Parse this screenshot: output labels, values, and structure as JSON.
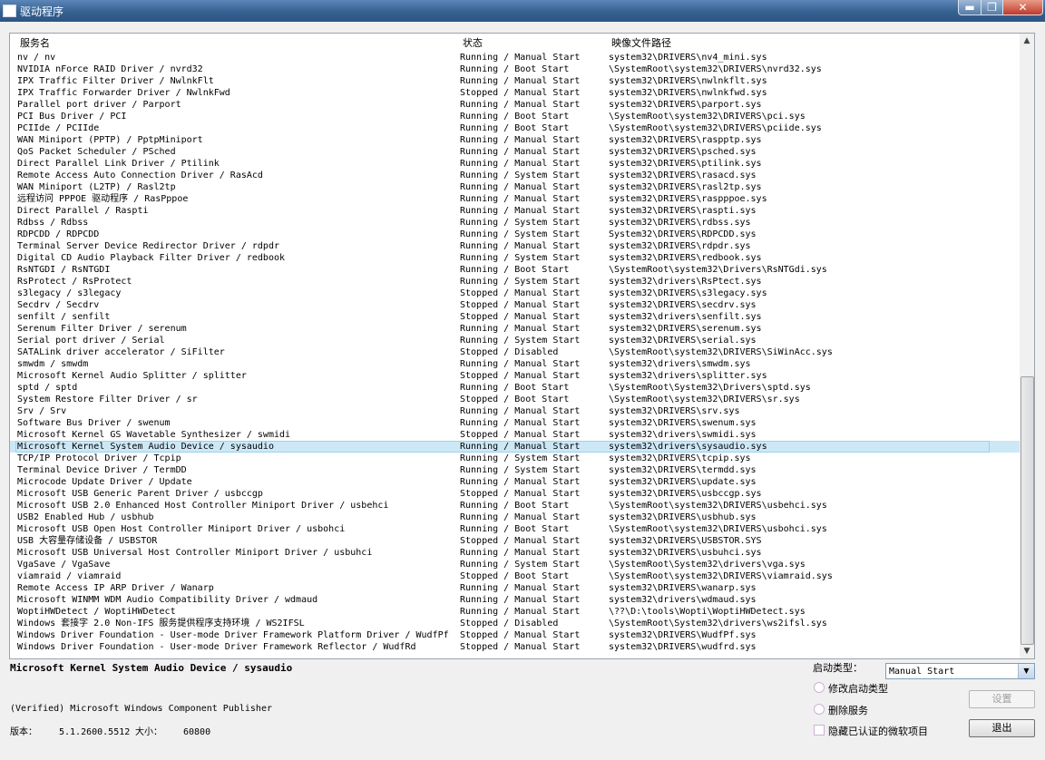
{
  "window": {
    "title": "驱动程序",
    "min_glyph": "▬",
    "max_glyph": "❐",
    "close_glyph": "✕"
  },
  "columns": {
    "name": "服务名",
    "status": "状态",
    "path": "映像文件路径"
  },
  "scroll": {
    "up": "▲",
    "down": "▼"
  },
  "rows": [
    [
      "nv / nv",
      "Running / Manual Start",
      "system32\\DRIVERS\\nv4_mini.sys"
    ],
    [
      "NVIDIA nForce RAID Driver / nvrd32",
      "Running / Boot Start",
      "\\SystemRoot\\system32\\DRIVERS\\nvrd32.sys"
    ],
    [
      "IPX Traffic Filter Driver / NwlnkFlt",
      "Running / Manual Start",
      "system32\\DRIVERS\\nwlnkflt.sys"
    ],
    [
      "IPX Traffic Forwarder Driver / NwlnkFwd",
      "Stopped / Manual Start",
      "system32\\DRIVERS\\nwlnkfwd.sys"
    ],
    [
      "Parallel port driver / Parport",
      "Running / Manual Start",
      "system32\\DRIVERS\\parport.sys"
    ],
    [
      "PCI Bus Driver / PCI",
      "Running / Boot Start",
      "\\SystemRoot\\system32\\DRIVERS\\pci.sys"
    ],
    [
      "PCIIde / PCIIde",
      "Running / Boot Start",
      "\\SystemRoot\\system32\\DRIVERS\\pciide.sys"
    ],
    [
      "WAN Miniport (PPTP) / PptpMiniport",
      "Running / Manual Start",
      "system32\\DRIVERS\\raspptp.sys"
    ],
    [
      "QoS Packet Scheduler / PSched",
      "Running / Manual Start",
      "system32\\DRIVERS\\psched.sys"
    ],
    [
      "Direct Parallel Link Driver / Ptilink",
      "Running / Manual Start",
      "system32\\DRIVERS\\ptilink.sys"
    ],
    [
      "Remote Access Auto Connection Driver / RasAcd",
      "Running / System Start",
      "system32\\DRIVERS\\rasacd.sys"
    ],
    [
      "WAN Miniport (L2TP) / Rasl2tp",
      "Running / Manual Start",
      "system32\\DRIVERS\\rasl2tp.sys"
    ],
    [
      "远程访问 PPPOE 驱动程序 / RasPppoe",
      "Running / Manual Start",
      "system32\\DRIVERS\\raspppoe.sys"
    ],
    [
      "Direct Parallel / Raspti",
      "Running / Manual Start",
      "system32\\DRIVERS\\raspti.sys"
    ],
    [
      "Rdbss / Rdbss",
      "Running / System Start",
      "system32\\DRIVERS\\rdbss.sys"
    ],
    [
      "RDPCDD / RDPCDD",
      "Running / System Start",
      "System32\\DRIVERS\\RDPCDD.sys"
    ],
    [
      "Terminal Server Device Redirector Driver / rdpdr",
      "Running / Manual Start",
      "system32\\DRIVERS\\rdpdr.sys"
    ],
    [
      "Digital CD Audio Playback Filter Driver / redbook",
      "Running / System Start",
      "system32\\DRIVERS\\redbook.sys"
    ],
    [
      "RsNTGDI / RsNTGDI",
      "Running / Boot Start",
      "\\SystemRoot\\system32\\Drivers\\RsNTGdi.sys"
    ],
    [
      "RsProtect / RsProtect",
      "Running / System Start",
      "system32\\drivers\\RsPtect.sys"
    ],
    [
      "s3legacy / s3legacy",
      "Stopped / Manual Start",
      "system32\\DRIVERS\\s3legacy.sys"
    ],
    [
      "Secdrv / Secdrv",
      "Stopped / Manual Start",
      "system32\\DRIVERS\\secdrv.sys"
    ],
    [
      "senfilt / senfilt",
      "Stopped / Manual Start",
      "system32\\drivers\\senfilt.sys"
    ],
    [
      "Serenum Filter Driver / serenum",
      "Running / Manual Start",
      "system32\\DRIVERS\\serenum.sys"
    ],
    [
      "Serial port driver / Serial",
      "Running / System Start",
      "system32\\DRIVERS\\serial.sys"
    ],
    [
      "SATALink driver accelerator / SiFilter",
      "Stopped / Disabled",
      "\\SystemRoot\\system32\\DRIVERS\\SiWinAcc.sys"
    ],
    [
      "smwdm / smwdm",
      "Running / Manual Start",
      "system32\\drivers\\smwdm.sys"
    ],
    [
      "Microsoft Kernel Audio Splitter / splitter",
      "Stopped / Manual Start",
      "system32\\drivers\\splitter.sys"
    ],
    [
      "sptd / sptd",
      "Running / Boot Start",
      "\\SystemRoot\\System32\\Drivers\\sptd.sys"
    ],
    [
      "System Restore Filter Driver / sr",
      "Stopped / Boot Start",
      "\\SystemRoot\\system32\\DRIVERS\\sr.sys"
    ],
    [
      "Srv / Srv",
      "Running / Manual Start",
      "system32\\DRIVERS\\srv.sys"
    ],
    [
      "Software Bus Driver / swenum",
      "Running / Manual Start",
      "system32\\DRIVERS\\swenum.sys"
    ],
    [
      "Microsoft Kernel GS Wavetable Synthesizer / swmidi",
      "Stopped / Manual Start",
      "system32\\drivers\\swmidi.sys"
    ],
    [
      "Microsoft Kernel System Audio Device / sysaudio",
      "Running / Manual Start",
      "system32\\drivers\\sysaudio.sys"
    ],
    [
      "TCP/IP Protocol Driver / Tcpip",
      "Running / System Start",
      "system32\\DRIVERS\\tcpip.sys"
    ],
    [
      "Terminal Device Driver / TermDD",
      "Running / System Start",
      "system32\\DRIVERS\\termdd.sys"
    ],
    [
      "Microcode Update Driver / Update",
      "Running / Manual Start",
      "system32\\DRIVERS\\update.sys"
    ],
    [
      "Microsoft USB Generic Parent Driver / usbccgp",
      "Stopped / Manual Start",
      "system32\\DRIVERS\\usbccgp.sys"
    ],
    [
      "Microsoft USB 2.0 Enhanced Host Controller Miniport Driver / usbehci",
      "Running / Boot Start",
      "\\SystemRoot\\system32\\DRIVERS\\usbehci.sys"
    ],
    [
      "USB2 Enabled Hub / usbhub",
      "Running / Manual Start",
      "system32\\DRIVERS\\usbhub.sys"
    ],
    [
      "Microsoft USB Open Host Controller Miniport Driver / usbohci",
      "Running / Boot Start",
      "\\SystemRoot\\system32\\DRIVERS\\usbohci.sys"
    ],
    [
      "USB 大容量存储设备 / USBSTOR",
      "Stopped / Manual Start",
      "system32\\DRIVERS\\USBSTOR.SYS"
    ],
    [
      "Microsoft USB Universal Host Controller Miniport Driver / usbuhci",
      "Running / Manual Start",
      "system32\\DRIVERS\\usbuhci.sys"
    ],
    [
      "VgaSave / VgaSave",
      "Running / System Start",
      "\\SystemRoot\\System32\\drivers\\vga.sys"
    ],
    [
      "viamraid / viamraid",
      "Stopped / Boot Start",
      "\\SystemRoot\\system32\\DRIVERS\\viamraid.sys"
    ],
    [
      "Remote Access IP ARP Driver / Wanarp",
      "Running / Manual Start",
      "system32\\DRIVERS\\wanarp.sys"
    ],
    [
      "Microsoft WINMM WDM Audio Compatibility Driver / wdmaud",
      "Running / Manual Start",
      "system32\\drivers\\wdmaud.sys"
    ],
    [
      "WoptiHWDetect / WoptiHWDetect",
      "Running / Manual Start",
      "\\??\\D:\\tools\\Wopti\\WoptiHWDetect.sys"
    ],
    [
      "Windows 套接字 2.0 Non-IFS 服务提供程序支持环境 / WS2IFSL",
      "Stopped / Disabled",
      "\\SystemRoot\\System32\\drivers\\ws2ifsl.sys"
    ],
    [
      "Windows Driver Foundation - User-mode Driver Framework Platform Driver / WudfPf",
      "Stopped / Manual Start",
      "system32\\DRIVERS\\WudfPf.sys"
    ],
    [
      "Windows Driver Foundation - User-mode Driver Framework Reflector / WudfRd",
      "Stopped / Manual Start",
      "system32\\DRIVERS\\wudfrd.sys"
    ]
  ],
  "selected_index": 33,
  "details": {
    "name": "Microsoft Kernel System Audio Device / sysaudio",
    "publisher": "(Verified) Microsoft Windows Component Publisher",
    "version_label": "版本：",
    "version": "5.1.2600.5512",
    "size_label": "大小：",
    "size": "60800"
  },
  "controls": {
    "start_type_label": "启动类型：",
    "start_type_value": "Manual Start",
    "combo_arrow": "▼",
    "modify_label": "修改启动类型",
    "delete_label": "删除服务",
    "hide_ms_label": "隐藏已认证的微软项目",
    "set_button": "设置",
    "exit_button": "退出"
  }
}
